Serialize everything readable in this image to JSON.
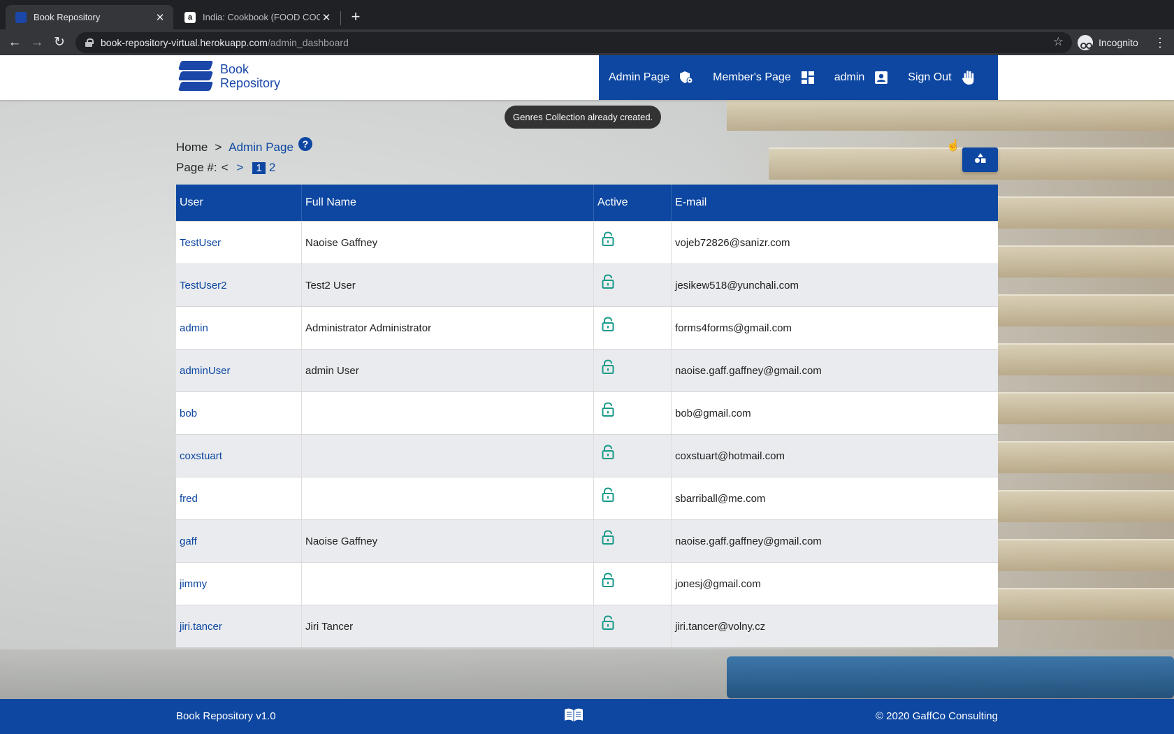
{
  "browser": {
    "tabs": [
      {
        "title": "Book Repository",
        "active": true
      },
      {
        "title": "India: Cookbook (FOOD COOK",
        "active": false
      }
    ],
    "url_host": "book-repository-virtual.herokuapp.com",
    "url_path": "/admin_dashboard",
    "profile_label": "Incognito"
  },
  "header": {
    "logo_line1": "Book",
    "logo_line2": "Repository",
    "menu": [
      {
        "label": "Admin Page",
        "icon": "admin-shield-icon"
      },
      {
        "label": "Member's Page",
        "icon": "dashboard-icon"
      },
      {
        "label": "admin",
        "icon": "account-box-icon"
      },
      {
        "label": "Sign Out",
        "icon": "hand-wave-icon"
      }
    ]
  },
  "toast": "Genres Collection already created.",
  "breadcrumb": {
    "home": "Home",
    "separator": ">",
    "current": "Admin Page",
    "help": "?"
  },
  "pager": {
    "label": "Page #:",
    "prev": "<",
    "next": ">",
    "current": "1",
    "other": "2"
  },
  "table": {
    "headers": [
      "User",
      "Full Name",
      "Active",
      "E-mail"
    ],
    "rows": [
      {
        "user": "TestUser",
        "full_name": "Naoise Gaffney",
        "email": "vojeb72826@sanizr.com"
      },
      {
        "user": "TestUser2",
        "full_name": "Test2 User",
        "email": "jesikew518@yunchali.com"
      },
      {
        "user": "admin",
        "full_name": "Administrator Administrator",
        "email": "forms4forms@gmail.com"
      },
      {
        "user": "adminUser",
        "full_name": "admin User",
        "email": "naoise.gaff.gaffney@gmail.com"
      },
      {
        "user": "bob",
        "full_name": "",
        "email": "bob@gmail.com"
      },
      {
        "user": "coxstuart",
        "full_name": "",
        "email": "coxstuart@hotmail.com"
      },
      {
        "user": "fred",
        "full_name": "",
        "email": "sbarriball@me.com"
      },
      {
        "user": "gaff",
        "full_name": "Naoise Gaffney",
        "email": "naoise.gaff.gaffney@gmail.com"
      },
      {
        "user": "jimmy",
        "full_name": "",
        "email": "jonesj@gmail.com"
      },
      {
        "user": "jiri.tancer",
        "full_name": "Jiri Tancer",
        "email": "jiri.tancer@volny.cz"
      }
    ]
  },
  "footer": {
    "left": "Book Repository v1.0",
    "right": "© 2020 GaffCo Consulting"
  },
  "colors": {
    "brand_blue": "#0d47a1",
    "lock_teal": "#1a9a8a"
  }
}
